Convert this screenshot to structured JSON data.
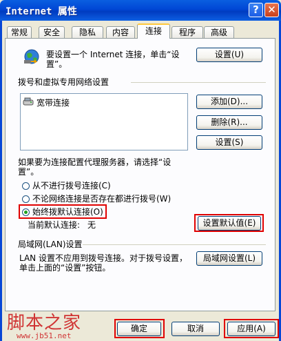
{
  "window": {
    "title": "Internet 属性",
    "help_label": "?",
    "close_label": "✕"
  },
  "tabs": [
    {
      "label": "常规"
    },
    {
      "label": "安全"
    },
    {
      "label": "隐私"
    },
    {
      "label": "内容"
    },
    {
      "label": "连接",
      "active": true
    },
    {
      "label": "程序"
    },
    {
      "label": "高级"
    }
  ],
  "setup": {
    "text": "要设置一个 Internet 连接，单击“设置”。",
    "button": "设置(U)",
    "icon": "globe-network-icon"
  },
  "dialup": {
    "heading": "拨号和虚拟专用网络设置",
    "connections": [
      {
        "label": "宽带连接",
        "icon": "broadband-connection-icon"
      }
    ],
    "add_button": "添加(D)...",
    "remove_button": "删除(R)...",
    "settings_button": "设置(S)",
    "proxy_hint": "如果要为连接配置代理服务器，请选择“设置”。",
    "options": [
      {
        "label": "从不进行拨号连接(C)",
        "selected": false
      },
      {
        "label": "不论网络连接是否存在都进行拨号(W)",
        "selected": false
      },
      {
        "label": "始终拨默认连接(O)",
        "selected": true
      }
    ],
    "current_default_label": "当前默认连接:",
    "current_default_value": "无",
    "set_default_button": "设置默认值(E)"
  },
  "lan": {
    "heading": "局域网(LAN)设置",
    "text": "LAN 设置不应用到拨号连接。对于拨号设置，单击上面的“设置”按钮。",
    "button": "局域网设置(L)"
  },
  "footer": {
    "ok_button": "确定",
    "cancel_button": "取消",
    "apply_button": "应用(A)"
  },
  "watermark": {
    "text": "脚本之家",
    "url": "www.jb51.net"
  },
  "colors": {
    "titlebar": "#0046d5",
    "highlight_box": "#e00000",
    "tab_accent": "#ffc83c"
  }
}
